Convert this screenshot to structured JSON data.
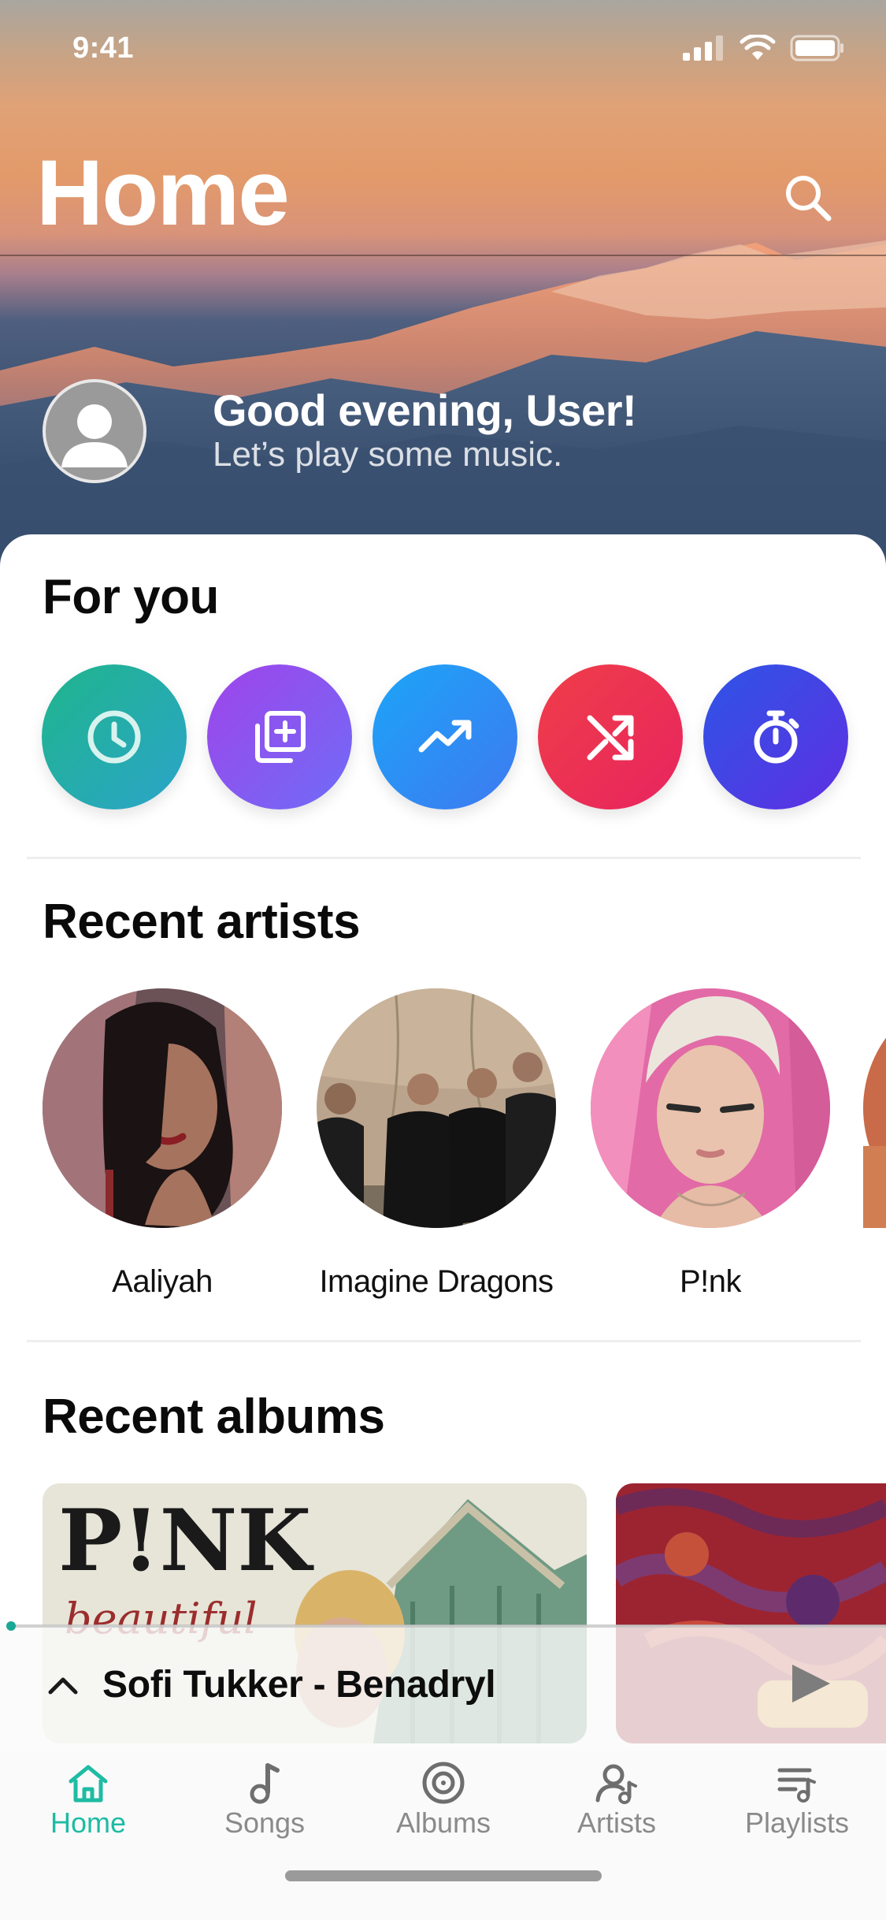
{
  "status_bar": {
    "time": "9:41"
  },
  "header": {
    "title": "Home",
    "search_icon": "search-icon"
  },
  "greeting": {
    "title": "Good evening, User!",
    "subtitle": "Let’s play some music."
  },
  "for_you": {
    "title": "For you",
    "items": [
      {
        "icon": "clock-icon",
        "colors": [
          "#1fb58c",
          "#2ba4c9"
        ]
      },
      {
        "icon": "add-to-library-icon",
        "colors": [
          "#a044ea",
          "#6f6cf7"
        ]
      },
      {
        "icon": "trending-icon",
        "colors": [
          "#1ba5f8",
          "#3f79f0"
        ]
      },
      {
        "icon": "shuffle-icon",
        "colors": [
          "#ef3e48",
          "#e8245f"
        ]
      },
      {
        "icon": "timer-icon",
        "colors": [
          "#2d55e6",
          "#5f2fe2"
        ]
      }
    ]
  },
  "recent_artists": {
    "title": "Recent artists",
    "items": [
      {
        "name": "Aaliyah"
      },
      {
        "name": "Imagine Dragons"
      },
      {
        "name": "P!nk"
      }
    ]
  },
  "recent_albums": {
    "title": "Recent albums",
    "items": [
      {
        "cover_text": "P!NK",
        "cover_script": "beautiful"
      }
    ]
  },
  "player": {
    "now_playing": "Sofi Tukker - Benadryl",
    "progress": 0.01
  },
  "tabs": [
    {
      "label": "Home",
      "icon": "home-icon",
      "active": true
    },
    {
      "label": "Songs",
      "icon": "music-note-icon",
      "active": false
    },
    {
      "label": "Albums",
      "icon": "album-icon",
      "active": false
    },
    {
      "label": "Artists",
      "icon": "artist-icon",
      "active": false
    },
    {
      "label": "Playlists",
      "icon": "playlist-icon",
      "active": false
    }
  ],
  "colors": {
    "accent": "#1dbca3",
    "inactive_tab": "#8a8a8a"
  }
}
